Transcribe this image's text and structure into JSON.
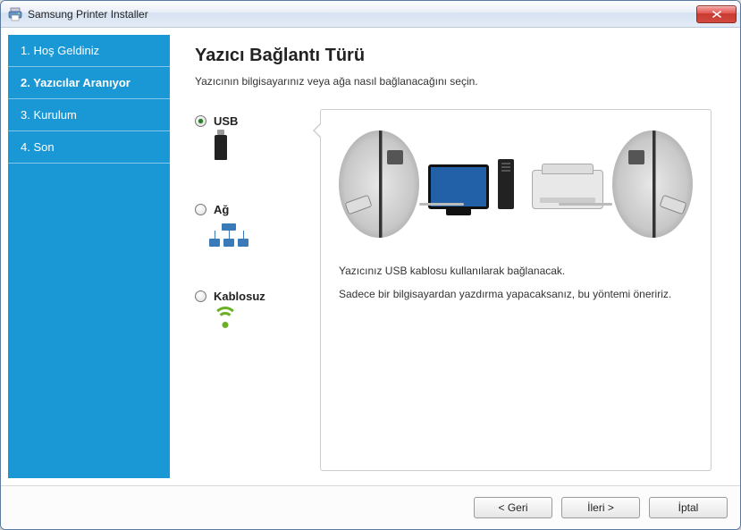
{
  "window": {
    "title": "Samsung Printer Installer"
  },
  "sidebar": {
    "steps": [
      {
        "label": "1. Hoş Geldiniz"
      },
      {
        "label": "2. Yazıcılar Aranıyor"
      },
      {
        "label": "3. Kurulum"
      },
      {
        "label": "4. Son"
      }
    ],
    "active_index": 1
  },
  "main": {
    "heading": "Yazıcı Bağlantı Türü",
    "subtitle": "Yazıcının bilgisayarınız veya ağa nasıl bağlanacağını seçin.",
    "options": [
      {
        "id": "usb",
        "label": "USB",
        "selected": true
      },
      {
        "id": "network",
        "label": "Ağ",
        "selected": false
      },
      {
        "id": "wireless",
        "label": "Kablosuz",
        "selected": false
      }
    ],
    "preview": {
      "line1": "Yazıcınız USB kablosu kullanılarak bağlanacak.",
      "line2": "Sadece bir bilgisayardan yazdırma yapacaksanız, bu yöntemi öneririz."
    }
  },
  "footer": {
    "back": "< Geri",
    "next": "İleri >",
    "cancel": "İptal"
  }
}
